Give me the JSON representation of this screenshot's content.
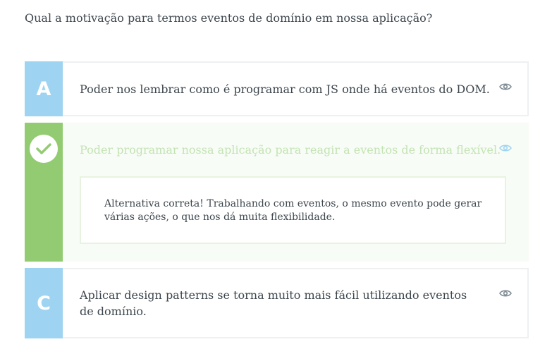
{
  "question": "Qual a motivação para termos eventos de domínio em nossa aplicação?",
  "alternatives": [
    {
      "letter": "A",
      "text": "Poder nos lembrar como é programar com JS onde há eventos do DOM.",
      "icon": "eye-icon"
    },
    {
      "status": "correct",
      "status_icon": "check-icon",
      "text": "Poder programar nossa aplicação para reagir a eventos de forma flexível.",
      "icon": "eye-icon",
      "feedback": "Alternativa correta! Trabalhando com eventos, o mesmo evento pode gerar várias ações, o que nos dá muita flexibilidade."
    },
    {
      "letter": "C",
      "text": "Aplicar design patterns se torna muito mais fácil utilizando eventos de domínio.",
      "icon": "eye-icon"
    }
  ],
  "colors": {
    "letter_bg": "#9ed4f2",
    "correct_bg": "#93cb72",
    "correct_text": "#c3e3b4",
    "eye_icon": "#7e8b94"
  }
}
